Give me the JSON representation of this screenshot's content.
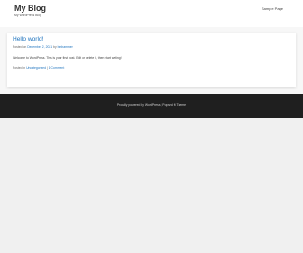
{
  "header": {
    "site_title": "My Blog",
    "tagline": "My WordPress Blog",
    "nav": [
      {
        "label": "Sample Page"
      }
    ]
  },
  "post": {
    "title": "Hello world!",
    "meta_prefix": "Posted on ",
    "date": "December 2, 2021",
    "meta_by": " by ",
    "author": "bmhammer",
    "excerpt": "Welcome to WordPress. This is your first post. Edit or delete it, then start writing!",
    "footer_prefix": "Posted in ",
    "category": "Uncategorized",
    "footer_sep": " | ",
    "comments": "1 Comment"
  },
  "footer": {
    "credit": "Proudly powered by WordPress | Popsed ft Theme"
  }
}
